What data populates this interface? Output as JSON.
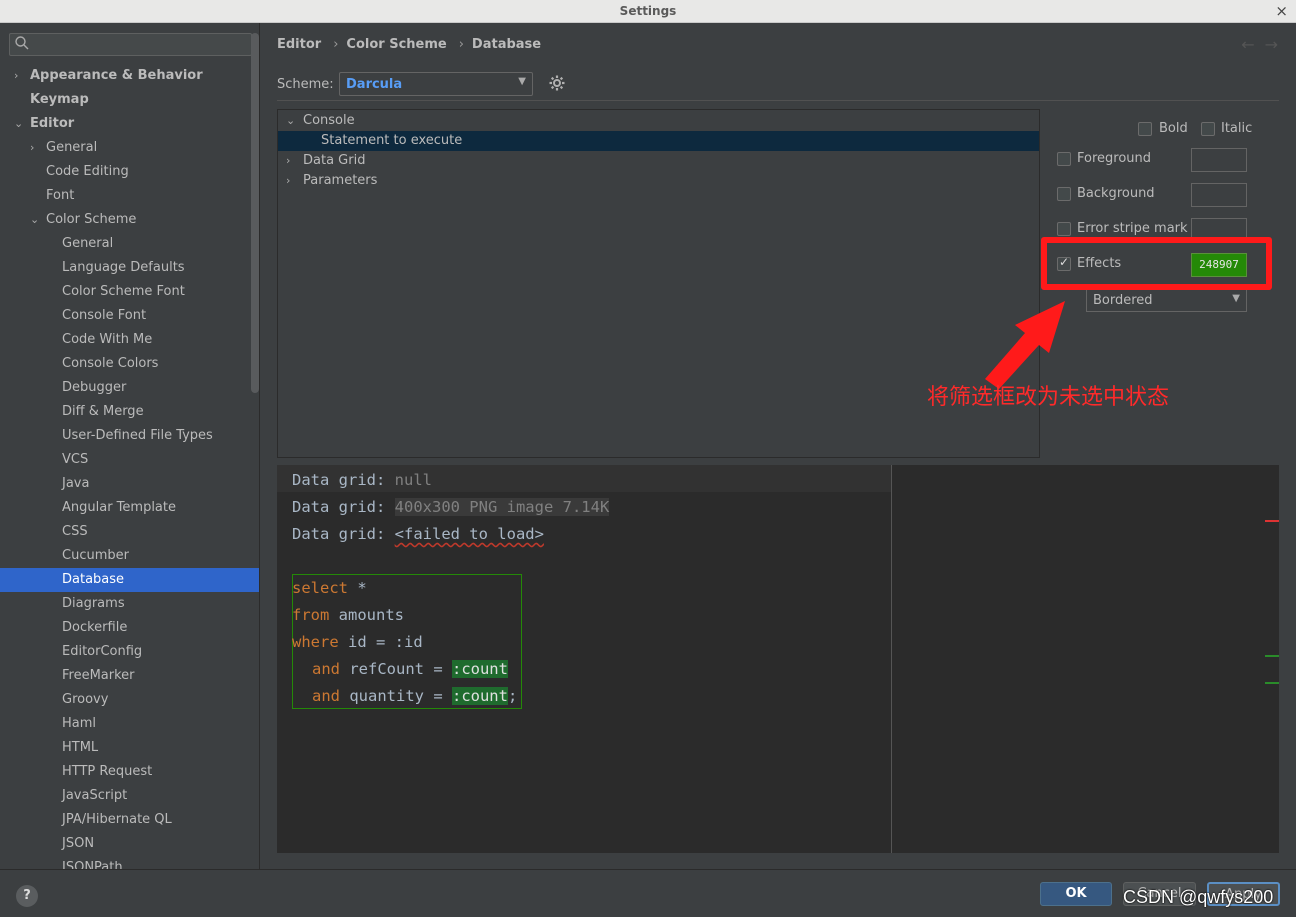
{
  "window": {
    "title": "Settings",
    "close": "×"
  },
  "search": {
    "icon": "search-icon",
    "value": ""
  },
  "sidebar": {
    "items": [
      {
        "label": "Appearance & Behavior",
        "arrow": "›",
        "indent": 0,
        "bold": true
      },
      {
        "label": "Keymap",
        "arrow": "",
        "indent": 0,
        "bold": true
      },
      {
        "label": "Editor",
        "arrow": "⌄",
        "indent": 0,
        "bold": true
      },
      {
        "label": "General",
        "arrow": "›",
        "indent": 1
      },
      {
        "label": "Code Editing",
        "arrow": "",
        "indent": 1
      },
      {
        "label": "Font",
        "arrow": "",
        "indent": 1
      },
      {
        "label": "Color Scheme",
        "arrow": "⌄",
        "indent": 1
      },
      {
        "label": "General",
        "arrow": "",
        "indent": 2
      },
      {
        "label": "Language Defaults",
        "arrow": "",
        "indent": 2
      },
      {
        "label": "Color Scheme Font",
        "arrow": "",
        "indent": 2
      },
      {
        "label": "Console Font",
        "arrow": "",
        "indent": 2
      },
      {
        "label": "Code With Me",
        "arrow": "",
        "indent": 2
      },
      {
        "label": "Console Colors",
        "arrow": "",
        "indent": 2
      },
      {
        "label": "Debugger",
        "arrow": "",
        "indent": 2
      },
      {
        "label": "Diff & Merge",
        "arrow": "",
        "indent": 2
      },
      {
        "label": "User-Defined File Types",
        "arrow": "",
        "indent": 2
      },
      {
        "label": "VCS",
        "arrow": "",
        "indent": 2
      },
      {
        "label": "Java",
        "arrow": "",
        "indent": 2
      },
      {
        "label": "Angular Template",
        "arrow": "",
        "indent": 2
      },
      {
        "label": "CSS",
        "arrow": "",
        "indent": 2
      },
      {
        "label": "Cucumber",
        "arrow": "",
        "indent": 2
      },
      {
        "label": "Database",
        "arrow": "",
        "indent": 2,
        "selected": true
      },
      {
        "label": "Diagrams",
        "arrow": "",
        "indent": 2
      },
      {
        "label": "Dockerfile",
        "arrow": "",
        "indent": 2
      },
      {
        "label": "EditorConfig",
        "arrow": "",
        "indent": 2
      },
      {
        "label": "FreeMarker",
        "arrow": "",
        "indent": 2
      },
      {
        "label": "Groovy",
        "arrow": "",
        "indent": 2
      },
      {
        "label": "Haml",
        "arrow": "",
        "indent": 2
      },
      {
        "label": "HTML",
        "arrow": "",
        "indent": 2
      },
      {
        "label": "HTTP Request",
        "arrow": "",
        "indent": 2
      },
      {
        "label": "JavaScript",
        "arrow": "",
        "indent": 2
      },
      {
        "label": "JPA/Hibernate QL",
        "arrow": "",
        "indent": 2
      },
      {
        "label": "JSON",
        "arrow": "",
        "indent": 2
      },
      {
        "label": "JSONPath",
        "arrow": "",
        "indent": 2
      }
    ]
  },
  "breadcrumb": {
    "items": [
      "Editor",
      "Color Scheme",
      "Database"
    ],
    "separator": "›",
    "back": "←",
    "forward": "→"
  },
  "scheme": {
    "label": "Scheme:",
    "value": "Darcula",
    "caret": "▼",
    "settings_icon": "gear-icon"
  },
  "attributes": {
    "items": [
      {
        "label": "Console",
        "arrow": "⌄",
        "indent": 0
      },
      {
        "label": "Statement to execute",
        "arrow": "",
        "indent": 1,
        "selected": true
      },
      {
        "label": "Data Grid",
        "arrow": "›",
        "indent": 0
      },
      {
        "label": "Parameters",
        "arrow": "›",
        "indent": 0
      }
    ]
  },
  "options": {
    "bold": {
      "label": "Bold",
      "checked": false
    },
    "italic": {
      "label": "Italic",
      "checked": false
    },
    "foreground": {
      "label": "Foreground",
      "checked": false
    },
    "background": {
      "label": "Background",
      "checked": false
    },
    "error_stripe": {
      "label": "Error stripe mark",
      "checked": false
    },
    "effects": {
      "label": "Effects",
      "checked": true,
      "check_mark": "✓",
      "color": "248907"
    },
    "effect_type": {
      "value": "Bordered",
      "caret": "▼"
    }
  },
  "annotation": {
    "text": "将筛选框改为未选中状态",
    "color": "#ff2a2a"
  },
  "preview": {
    "lines": [
      {
        "prefix": "Data grid: ",
        "value": "null"
      },
      {
        "prefix": "Data grid: ",
        "value": "400x300 PNG image 7.14K"
      },
      {
        "prefix": "Data grid: ",
        "value": "<failed to load>"
      }
    ],
    "sql": {
      "kw_select": "select",
      "star": " *",
      "kw_from": "from",
      "table": " amounts",
      "kw_where": "where",
      "where_cond": " id = :id",
      "kw_and1": "and",
      "cond1": " refCount = ",
      "param1": ":count",
      "kw_and2": "and",
      "cond2": " quantity = ",
      "param2": ":count",
      "end": ";"
    }
  },
  "footer": {
    "help": "?",
    "ok": "OK",
    "cancel": "Cancel",
    "apply": "Apply",
    "watermark": "CSDN @qwfys200"
  },
  "colors": {
    "accent": "#2f65ca",
    "effect": "#248907",
    "keyword": "#cc7832",
    "annotation": "#ff2a2a"
  }
}
